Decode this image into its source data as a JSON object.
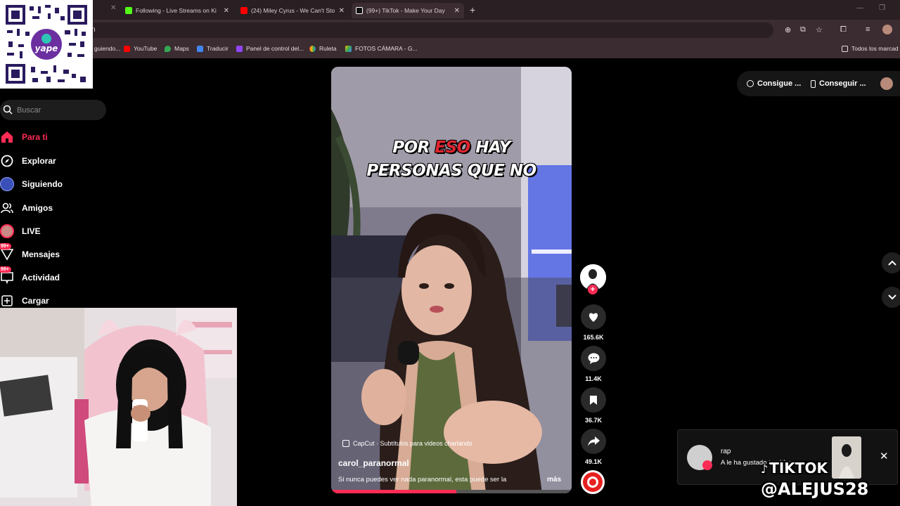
{
  "browser": {
    "tabs": [
      {
        "title": "Following - Live Streams on Ki",
        "favicon_color": "#53fc18"
      },
      {
        "title": "(24) Miley Cyrus - We Can't Sto",
        "favicon_color": "#ff0000"
      },
      {
        "title": "(99+) TikTok - Make Your Day",
        "favicon_color": "#000000"
      }
    ],
    "address_fragment": "n",
    "bookmarks": [
      {
        "label": "guiendo...",
        "color": "#9b59b6"
      },
      {
        "label": "YouTube",
        "color": "#ff0000"
      },
      {
        "label": "Maps",
        "color": "#34a853"
      },
      {
        "label": "Traducir",
        "color": "#4285f4"
      },
      {
        "label": "Panel de control del...",
        "color": "#9146ff"
      },
      {
        "label": "Ruleta",
        "color": "#ea4335"
      },
      {
        "label": "FOTOS CÁMARA - G...",
        "color": "#fbbc05"
      }
    ],
    "bookmarks_all": "Todos los marcad"
  },
  "sidebar": {
    "search_placeholder": "Buscar",
    "items": [
      {
        "label": "Para ti",
        "icon": "home-icon",
        "active": true
      },
      {
        "label": "Explorar",
        "icon": "compass-icon"
      },
      {
        "label": "Siguiendo",
        "icon": "following-avatar-icon"
      },
      {
        "label": "Amigos",
        "icon": "friends-icon"
      },
      {
        "label": "LIVE",
        "icon": "live-avatar-icon"
      },
      {
        "label": "Mensajes",
        "icon": "messages-icon",
        "badge": "99+"
      },
      {
        "label": "Actividad",
        "icon": "activity-icon",
        "badge": "99+"
      },
      {
        "label": "Cargar",
        "icon": "upload-icon"
      }
    ]
  },
  "topright": {
    "coins_label": "Consigue ...",
    "app_label": "Conseguir ..."
  },
  "video": {
    "caption_line1_a": "POR ",
    "caption_line1_hl": "ESO",
    "caption_line1_b": " HAY",
    "caption_line2": "PERSONAS QUE NO",
    "capcut": "CapCut · Subtítulos para videos charlando",
    "author": "carol_paranormal",
    "description": "Si nunca puedes ver nada paranormal, esta puede ser la",
    "more": "más",
    "progress_fraction": 0.52
  },
  "actions": {
    "likes": "165.6K",
    "comments": "11.4K",
    "saves": "36.7K",
    "shares": "49.1K"
  },
  "notification": {
    "user": "rap",
    "text": "A le ha gustado tu vídeo"
  },
  "watermark": {
    "line1": "TIKTOK",
    "line2": "@ALEJUS28"
  }
}
